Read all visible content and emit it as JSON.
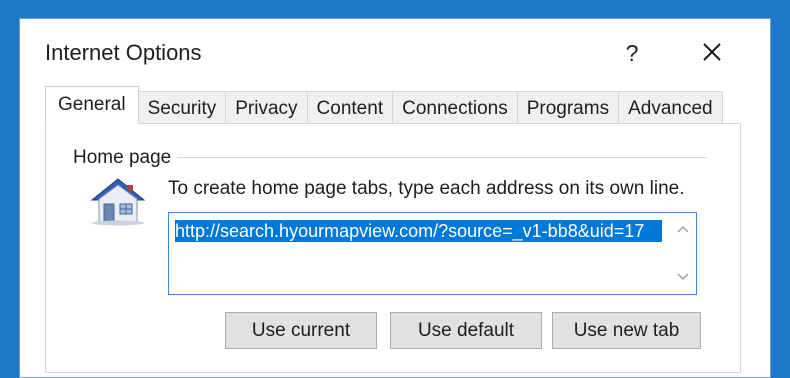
{
  "window": {
    "title": "Internet Options",
    "help_label": "?",
    "close_icon": "close-icon"
  },
  "tabs": [
    {
      "label": "General",
      "active": true
    },
    {
      "label": "Security",
      "active": false
    },
    {
      "label": "Privacy",
      "active": false
    },
    {
      "label": "Content",
      "active": false
    },
    {
      "label": "Connections",
      "active": false
    },
    {
      "label": "Programs",
      "active": false
    },
    {
      "label": "Advanced",
      "active": false
    }
  ],
  "home_page": {
    "group_label": "Home page",
    "icon": "house-icon",
    "instructions": "To create home page tabs, type each address on its own line.",
    "url_value": "http://search.hyourmapview.com/?source=_v1-bb8&uid=17",
    "buttons": {
      "use_current": "Use current",
      "use_default": "Use default",
      "use_new_tab": "Use new tab"
    }
  },
  "colors": {
    "desktop_bg": "#1c79c9",
    "selection": "#0078d7",
    "focus_border": "#3d84d2",
    "button_bg": "#e1e1e1"
  }
}
